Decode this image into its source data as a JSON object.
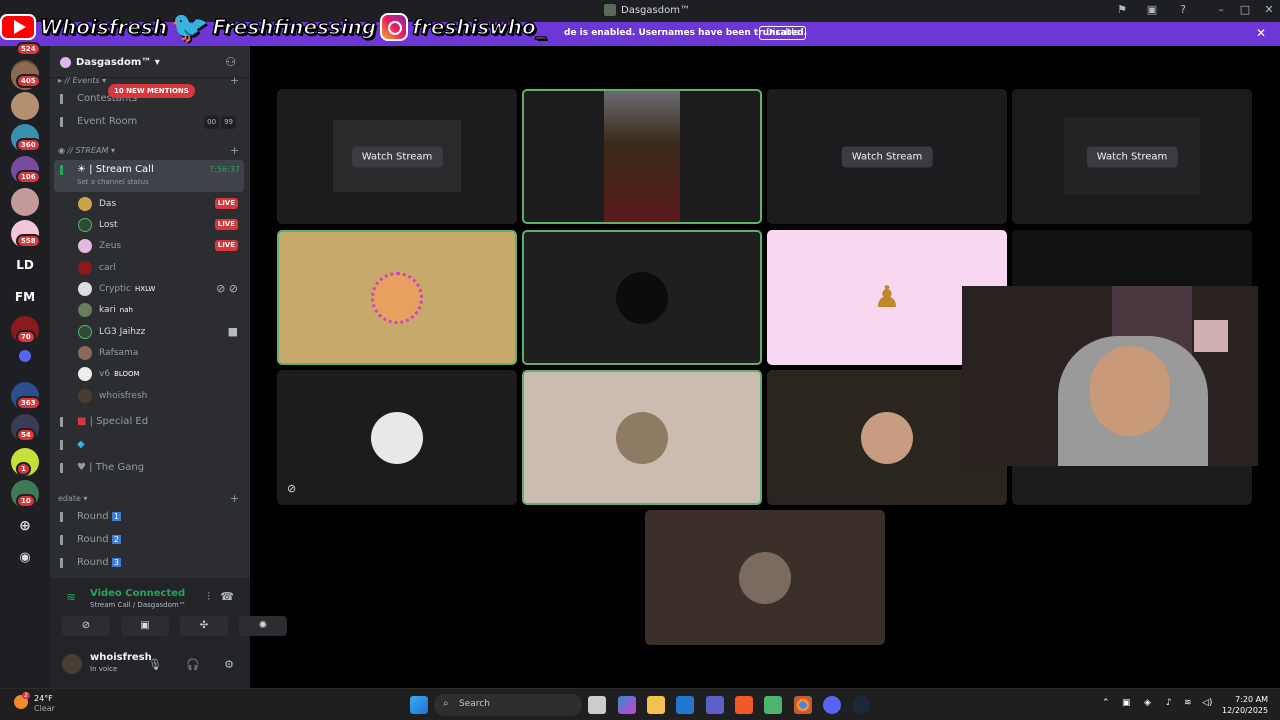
{
  "window": {
    "title": "Dasgasdom™"
  },
  "notice": {
    "text": "de is enabled. Usernames have been truncated.",
    "button": "Disable"
  },
  "overlay": {
    "youtube": "Whoisfresh",
    "twitter": "Freshfinessing",
    "instagram": "freshiswho_"
  },
  "rail": {
    "badges": [
      "524",
      "405",
      "360",
      "106",
      "558",
      "70",
      "363",
      "54",
      "1",
      "10"
    ],
    "text_items": [
      "LD",
      "FM"
    ]
  },
  "sidebar": {
    "server_name": "Dasgasdom™",
    "mentions": "10 NEW MENTIONS",
    "categories": {
      "events": "// Events",
      "stream": "// STREAM",
      "edate": "edate"
    },
    "channels": {
      "contestants": "Contestants",
      "event_room": "Event Room",
      "event_room_counts": [
        "00",
        "99"
      ],
      "stream_call": "Stream Call",
      "stream_timer": "7:56:37",
      "stream_status": "Set a channel status",
      "special_ed": "Special Ed",
      "the_gang": "The Gang",
      "round1": "Round",
      "round2": "Round",
      "round3": "Round",
      "round_nums": [
        "1",
        "2",
        "3"
      ]
    },
    "users": [
      {
        "name": "Das",
        "live": "LIVE"
      },
      {
        "name": "Lost",
        "live": "LIVE"
      },
      {
        "name": "Zeus",
        "live": "LIVE"
      },
      {
        "name": "carl"
      },
      {
        "name": "Cryptic",
        "tag": "HXLW"
      },
      {
        "name": "kari",
        "tag": "nah"
      },
      {
        "name": "LG3 Jaihzz"
      },
      {
        "name": "Rafsama"
      },
      {
        "name": "v6",
        "tag": "BLOOM"
      },
      {
        "name": "whoisfresh"
      }
    ]
  },
  "voice": {
    "status": "Video Connected",
    "channel": "Stream Call / Dasgasdom™"
  },
  "me": {
    "name": "whoisfresh",
    "status": "In voice"
  },
  "grid": {
    "watch_label": "Watch Stream"
  },
  "taskbar": {
    "weather_temp": "24°F",
    "weather_cond": "Clear",
    "weather_alert": "2",
    "search": "Search",
    "time": "7:20 AM",
    "date": "12/20/2025"
  },
  "colors": {
    "accent": "#6c37d4",
    "speaking": "#5fb06a",
    "live": "#da373c",
    "connected": "#23a55a"
  }
}
